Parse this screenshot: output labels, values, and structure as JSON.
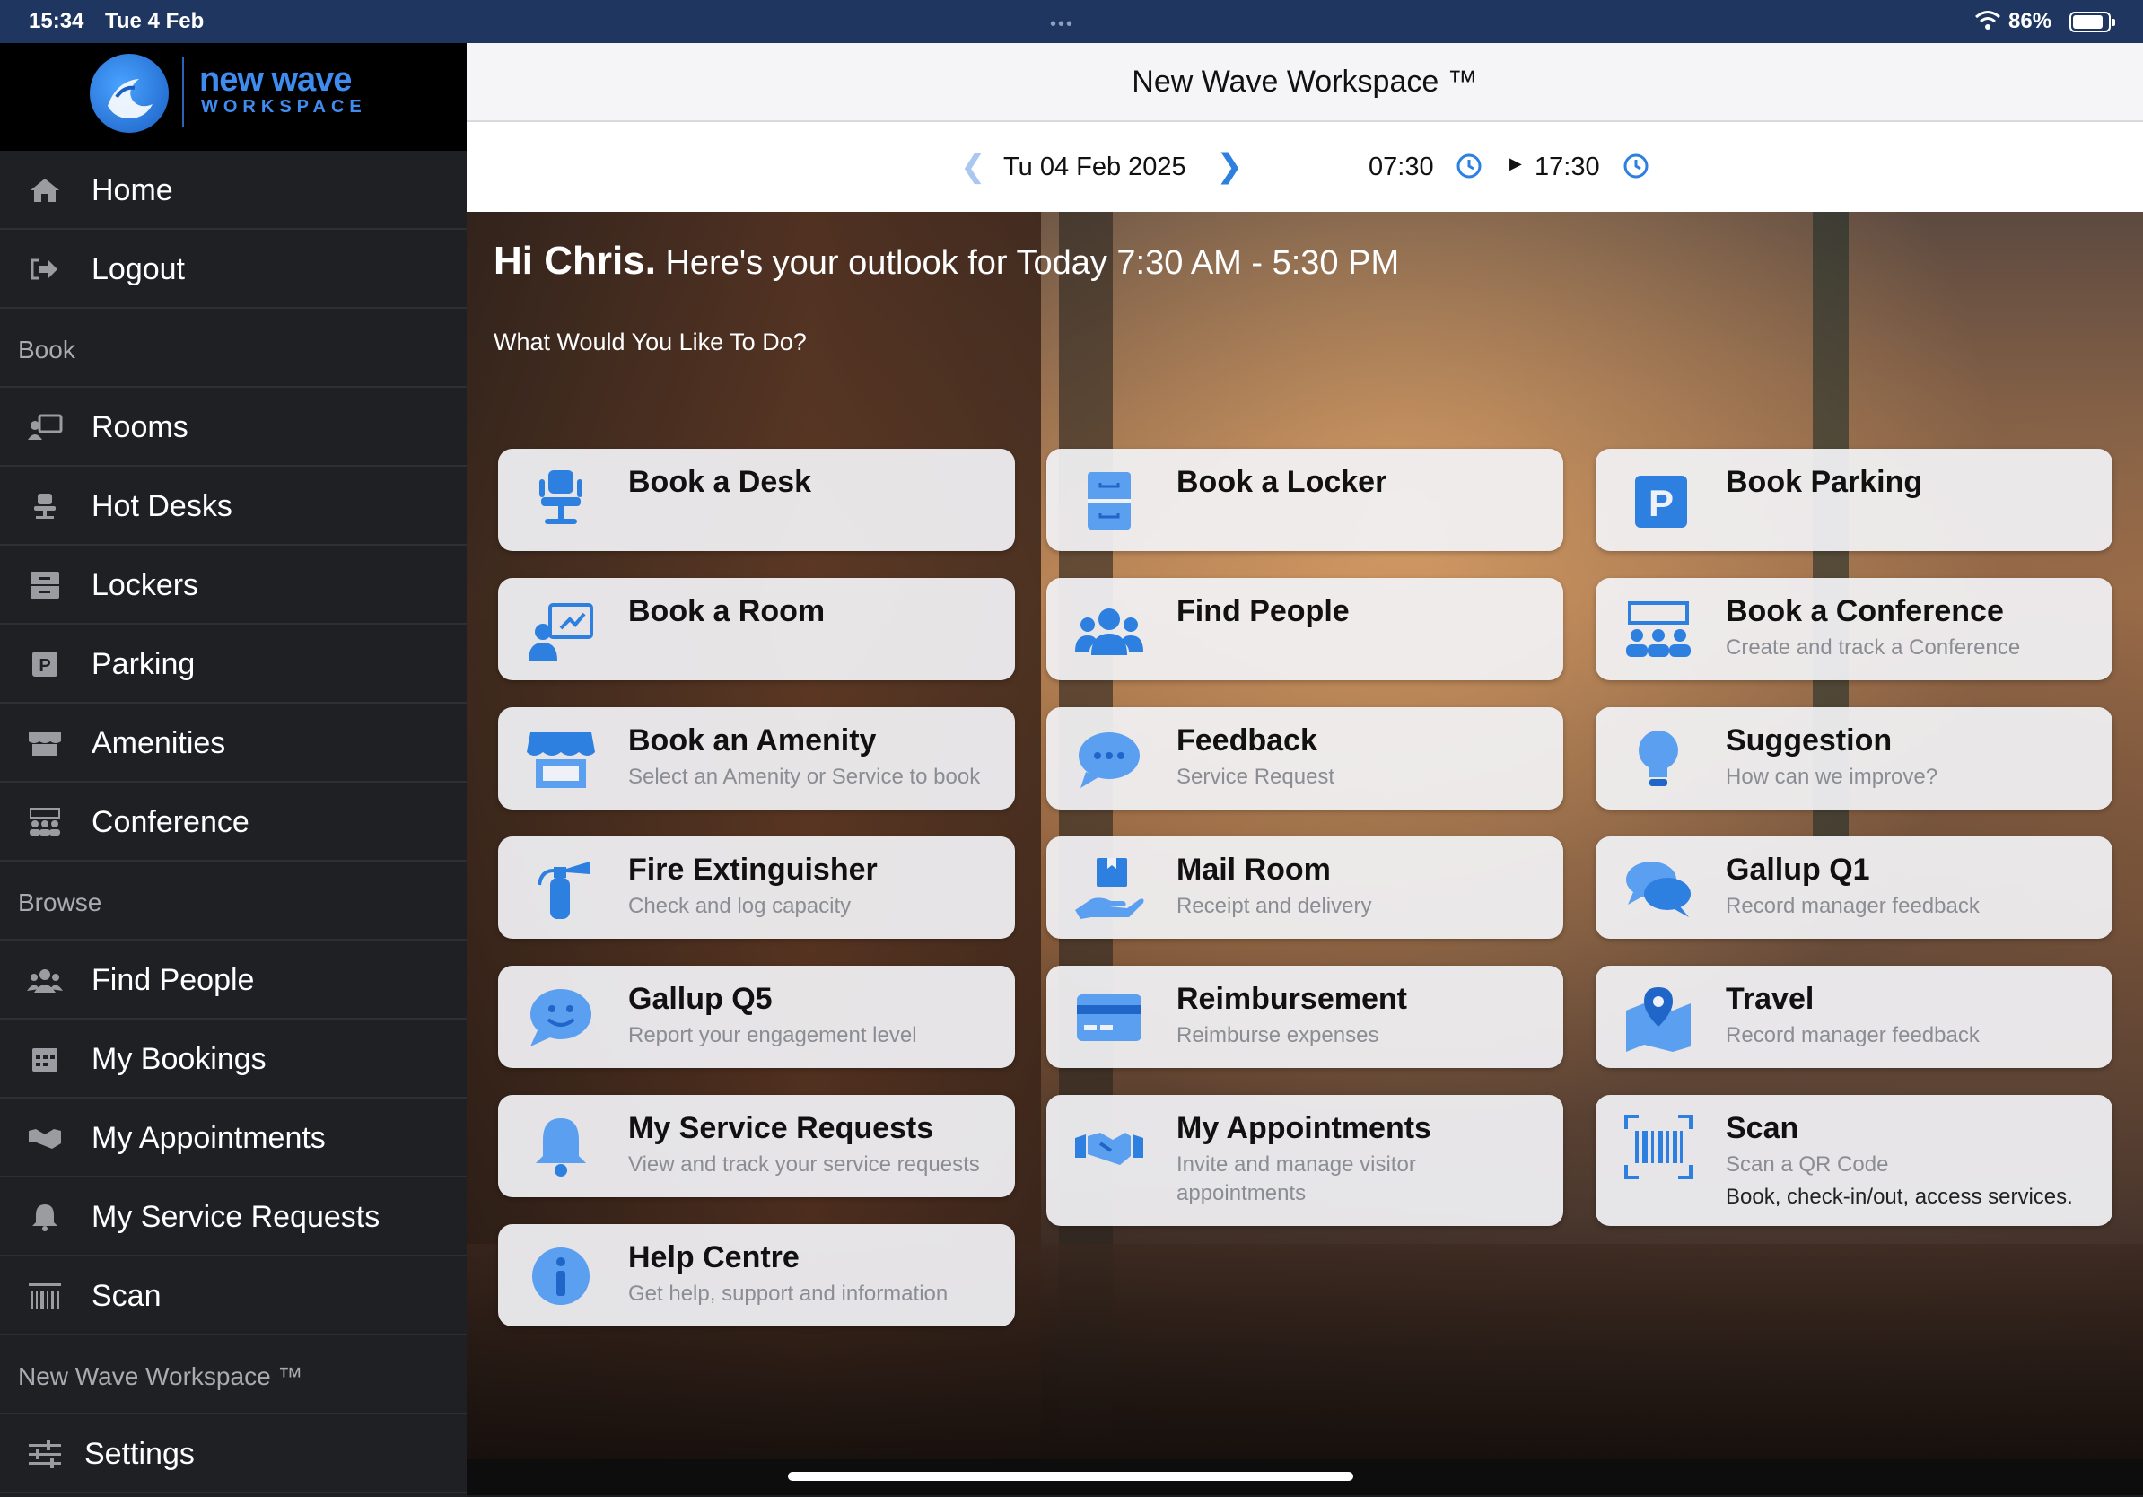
{
  "status_bar": {
    "time": "15:34",
    "date": "Tue 4 Feb",
    "battery": "86%"
  },
  "logo": {
    "title": "new wave",
    "subtitle": "WORKSPACE"
  },
  "sidebar": {
    "top_items": [
      {
        "label": "Home",
        "icon": "home-icon"
      },
      {
        "label": "Logout",
        "icon": "logout-icon"
      }
    ],
    "book_heading": "Book",
    "book_items": [
      {
        "label": "Rooms",
        "icon": "room-icon"
      },
      {
        "label": "Hot Desks",
        "icon": "desk-icon"
      },
      {
        "label": "Lockers",
        "icon": "locker-icon"
      },
      {
        "label": "Parking",
        "icon": "parking-icon"
      },
      {
        "label": "Amenities",
        "icon": "amenity-icon"
      },
      {
        "label": "Conference",
        "icon": "conference-icon"
      }
    ],
    "browse_heading": "Browse",
    "browse_items": [
      {
        "label": "Find People",
        "icon": "people-icon"
      },
      {
        "label": "My Bookings",
        "icon": "calendar-icon"
      },
      {
        "label": "My Appointments",
        "icon": "handshake-icon"
      },
      {
        "label": "My Service Requests",
        "icon": "bell-icon"
      },
      {
        "label": "Scan",
        "icon": "barcode-icon"
      }
    ],
    "footer_heading": "New Wave Workspace ™",
    "footer_items": [
      {
        "label": "Settings",
        "icon": "settings-sliders-icon"
      }
    ]
  },
  "header": {
    "title": "New Wave Workspace ™"
  },
  "datebar": {
    "date": "Tu 04 Feb 2025",
    "start_time": "07:30",
    "end_time": "17:30"
  },
  "greeting": {
    "name": "Hi Chris.",
    "outlook": "Here's your outlook for Today 7:30 AM - 5:30 PM"
  },
  "prompt": "What Would You Like To Do?",
  "accent_color": "#1f7ae0",
  "tiles": [
    {
      "title": "Book a Desk",
      "subtitle": "",
      "icon": "desk-chair-icon"
    },
    {
      "title": "Book a Locker",
      "subtitle": "",
      "icon": "locker-icon"
    },
    {
      "title": "Book Parking",
      "subtitle": "",
      "icon": "parking-icon"
    },
    {
      "title": "Book a Room",
      "subtitle": "",
      "icon": "presentation-icon"
    },
    {
      "title": "Find People",
      "subtitle": "",
      "icon": "people-icon"
    },
    {
      "title": "Book a Conference",
      "subtitle": "Create and track a Conference",
      "icon": "conference-icon"
    },
    {
      "title": "Book an Amenity",
      "subtitle": "Select an Amenity or Service to book",
      "icon": "store-icon"
    },
    {
      "title": "Feedback",
      "subtitle": "Service Request",
      "icon": "chat-bubble-icon"
    },
    {
      "title": "Suggestion",
      "subtitle": "How can we improve?",
      "icon": "lightbulb-icon"
    },
    {
      "title": "Fire Extinguisher",
      "subtitle": "Check and log capacity",
      "icon": "fire-extinguisher-icon"
    },
    {
      "title": "Mail Room",
      "subtitle": "Receipt and delivery",
      "icon": "package-hand-icon"
    },
    {
      "title": "Gallup Q1",
      "subtitle": "Record manager feedback",
      "icon": "chat-bubbles-icon"
    },
    {
      "title": "Gallup Q5",
      "subtitle": "Report your engagement level",
      "icon": "smile-chat-icon"
    },
    {
      "title": "Reimbursement",
      "subtitle": "Reimburse expenses",
      "icon": "credit-card-icon"
    },
    {
      "title": "Travel",
      "subtitle": "Record manager feedback",
      "icon": "map-pin-icon"
    },
    {
      "title": "My Service Requests",
      "subtitle": "View and track your service requests",
      "icon": "bell-icon"
    },
    {
      "title": "My Appointments",
      "subtitle": "Invite and manage visitor",
      "subtitle2": "appointments",
      "icon": "handshake-icon"
    },
    {
      "title": "Scan",
      "subtitle": "Scan a QR Code",
      "subtitle2": "Book, check-in/out, access services.",
      "icon": "barcode-scan-icon"
    },
    {
      "title": "Help Centre",
      "subtitle": "Get help, support and information",
      "icon": "info-icon"
    }
  ]
}
